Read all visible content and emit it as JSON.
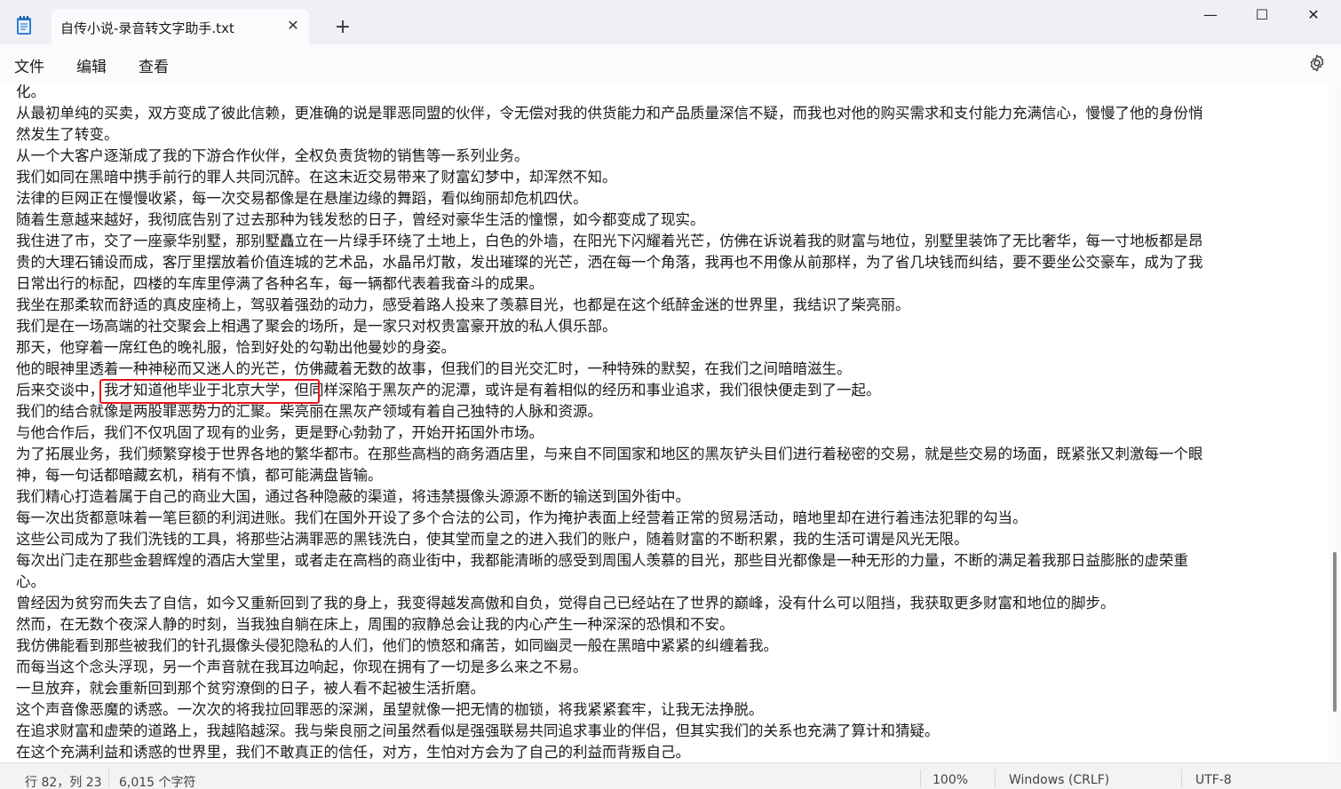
{
  "window": {
    "tab_title": "自传小说-录音转文字助手.txt",
    "tab_close": "✕",
    "new_tab": "+",
    "minimize": "—",
    "maximize": "☐",
    "close": "✕"
  },
  "menu": {
    "file": "文件",
    "edit": "编辑",
    "view": "查看"
  },
  "editor": {
    "lines": [
      "化。",
      "从最初单纯的买卖，双方变成了彼此信赖，更准确的说是罪恶同盟的伙伴，令无偿对我的供货能力和产品质量深信不疑，而我也对他的购买需求和支付能力充满信心，慢慢了他的身份悄",
      "然发生了转变。",
      "从一个大客户逐渐成了我的下游合作伙伴，全权负责货物的销售等一系列业务。",
      "我们如同在黑暗中携手前行的罪人共同沉醉。在这末近交易带来了财富幻梦中，却浑然不知。",
      "法律的巨网正在慢慢收紧，每一次交易都像是在悬崖边缘的舞蹈，看似绚丽却危机四伏。",
      "随着生意越来越好，我彻底告别了过去那种为钱发愁的日子，曾经对豪华生活的憧憬，如今都变成了现实。",
      "我住进了市，交了一座豪华别墅，那别墅矗立在一片绿手环绕了土地上，白色的外墙，在阳光下闪耀着光芒，仿佛在诉说着我的财富与地位，别墅里装饰了无比奢华，每一寸地板都是昂",
      "贵的大理石铺设而成，客厅里摆放着价值连城的艺术品，水晶吊灯散，发出璀璨的光芒，洒在每一个角落，我再也不用像从前那样，为了省几块钱而纠结，要不要坐公交豪车，成为了我",
      "日常出行的标配，四楼的车库里停满了各种名车，每一辆都代表着我奋斗的成果。",
      "我坐在那柔软而舒适的真皮座椅上，驾驭着强劲的动力，感受着路人投来了羡慕目光，也都是在这个纸醉金迷的世界里，我结识了柴亮丽。",
      "我们是在一场高端的社交聚会上相遇了聚会的场所，是一家只对权贵富豪开放的私人俱乐部。",
      "那天，他穿着一席红色的晚礼服，恰到好处的勾勒出他曼妙的身姿。",
      "他的眼神里透着一种神秘而又迷人的光芒，仿佛藏着无数的故事，但我们的目光交汇时，一种特殊的默契，在我们之间暗暗滋生。",
      "后来交谈中，我才知道他毕业于北京大学，但同样深陷于黑灰产的泥潭，或许是有着相似的经历和事业追求，我们很快便走到了一起。",
      "我们的结合就像是两股罪恶势力的汇聚。柴亮丽在黑灰产领域有着自己独特的人脉和资源。",
      "与他合作后，我们不仅巩固了现有的业务，更是野心勃勃了，开始开拓国外市场。",
      "为了拓展业务，我们频繁穿梭于世界各地的繁华都市。在那些高档的商务酒店里，与来自不同国家和地区的黑灰铲头目们进行着秘密的交易，就是些交易的场面，既紧张又刺激每一个眼",
      "神，每一句话都暗藏玄机，稍有不慎，都可能满盘皆输。",
      "我们精心打造着属于自己的商业大国，通过各种隐蔽的渠道，将违禁摄像头源源不断的输送到国外街中。",
      "每一次出货都意味着一笔巨额的利润进账。我们在国外开设了多个合法的公司，作为掩护表面上经营着正常的贸易活动，暗地里却在进行着违法犯罪的勾当。",
      "这些公司成为了我们洗钱的工具，将那些沾满罪恶的黑钱洗白，使其堂而皇之的进入我们的账户，随着财富的不断积累，我的生活可谓是风光无限。",
      "每次出门走在那些金碧辉煌的酒店大堂里，或者走在高档的商业街中，我都能清晰的感受到周围人羡慕的目光，那些目光都像是一种无形的力量，不断的满足着我那日益膨胀的虚荣重",
      "心。",
      "曾经因为贫穷而失去了自信，如今又重新回到了我的身上，我变得越发高傲和自负，觉得自己已经站在了世界的巅峰，没有什么可以阻挡，我获取更多财富和地位的脚步。",
      "然而，在无数个夜深人静的时刻，当我独自躺在床上，周围的寂静总会让我的内心产生一种深深的恐惧和不安。",
      "我仿佛能看到那些被我们的针孔摄像头侵犯隐私的人们，他们的愤怒和痛苦，如同幽灵一般在黑暗中紧紧的纠缠着我。",
      "而每当这个念头浮现，另一个声音就在我耳边响起，你现在拥有了一切是多么来之不易。",
      "一旦放弃，就会重新回到那个贫穷潦倒的日子，被人看不起被生活折磨。",
      "这个声音像恶魔的诱惑。一次次的将我拉回罪恶的深渊，虽望就像一把无情的枷锁，将我紧紧套牢，让我无法挣脱。",
      "在追求财富和虚荣的道路上，我越陷越深。我与柴良丽之间虽然看似是强强联易共同追求事业的伴侣，但其实我们的关系也充满了算计和猜疑。",
      "在这个充满利益和诱惑的世界里，我们不敢真正的信任，对方，生怕对方会为了自己的利益而背叛自己。"
    ]
  },
  "status": {
    "position": "行 82，列 23",
    "chars": "6,015 个字符",
    "zoom": "100%",
    "eol": "Windows (CRLF)",
    "encoding": "UTF-8"
  },
  "colors": {
    "highlight": "#e8121b",
    "titlebar": "#eef0f6",
    "statusbar": "#f3f3f5"
  }
}
